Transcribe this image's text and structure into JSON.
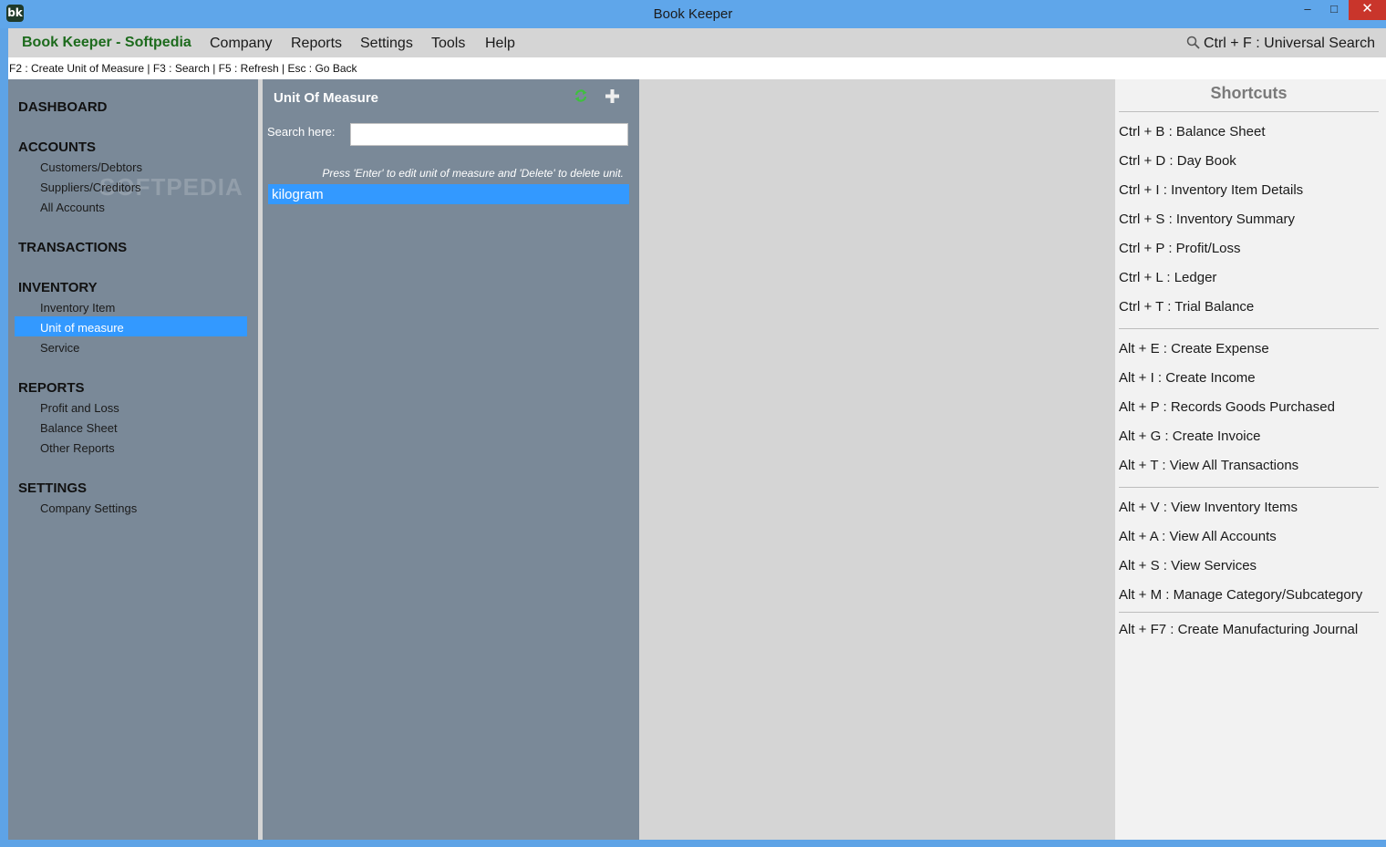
{
  "window": {
    "title": "Book Keeper",
    "icon_text": "bk",
    "minimize_glyph": "–",
    "maximize_glyph": "□",
    "close_glyph": "✕"
  },
  "menubar": {
    "brand": "Book Keeper - Softpedia",
    "items": [
      "Company",
      "Reports",
      "Settings",
      "Tools",
      "Help"
    ],
    "universal_search": "Ctrl + F  : Universal Search"
  },
  "hintbar": {
    "text": "F2 : Create Unit of Measure | F3 : Search | F5 : Refresh | Esc : Go Back"
  },
  "sidebar": {
    "watermark": "SOFTPEDIA",
    "sections": {
      "dashboard": "DASHBOARD",
      "accounts": "ACCOUNTS",
      "transactions": "TRANSACTIONS",
      "inventory": "INVENTORY",
      "reports": "REPORTS",
      "settings": "SETTINGS"
    },
    "items": {
      "customers": "Customers/Debtors",
      "suppliers": "Suppliers/Creditors",
      "all_accounts": "All Accounts",
      "inventory_item": "Inventory Item",
      "unit_of_measure": "Unit of measure",
      "service": "Service",
      "profit_loss": "Profit and Loss",
      "balance_sheet": "Balance Sheet",
      "other_reports": "Other Reports",
      "company_settings": "Company Settings"
    },
    "selected": "Unit of measure"
  },
  "uom_panel": {
    "title": "Unit Of Measure",
    "search_label": "Search here:",
    "search_value": "",
    "list_hint": "Press 'Enter' to edit unit of measure and 'Delete' to delete unit.",
    "rows": [
      "kilogram"
    ],
    "refresh_icon": "refresh-icon",
    "add_icon": "plus-icon"
  },
  "shortcuts": {
    "title": "Shortcuts",
    "items": [
      "Ctrl + B : Balance Sheet",
      "Ctrl + D : Day Book",
      "Ctrl + I  : Inventory Item Details",
      "Ctrl + S : Inventory Summary",
      "Ctrl + P : Profit/Loss",
      "Ctrl + L : Ledger",
      "Ctrl + T : Trial Balance",
      "Alt + E : Create Expense",
      "Alt + I  : Create Income",
      "Alt + P : Records Goods Purchased",
      "Alt + G : Create Invoice",
      "Alt + T : View All Transactions",
      "Alt + V : View Inventory Items",
      "Alt + A : View All Accounts",
      "Alt + S : View Services",
      "Alt + M : Manage Category/Subcategory",
      "Alt + F7 : Create Manufacturing Journal"
    ]
  },
  "colors": {
    "titlebar": "#5fa6ea",
    "brand": "#1d6b1d",
    "panel": "#7a8998",
    "selection": "#3399ff",
    "close_button": "#c9352b"
  }
}
